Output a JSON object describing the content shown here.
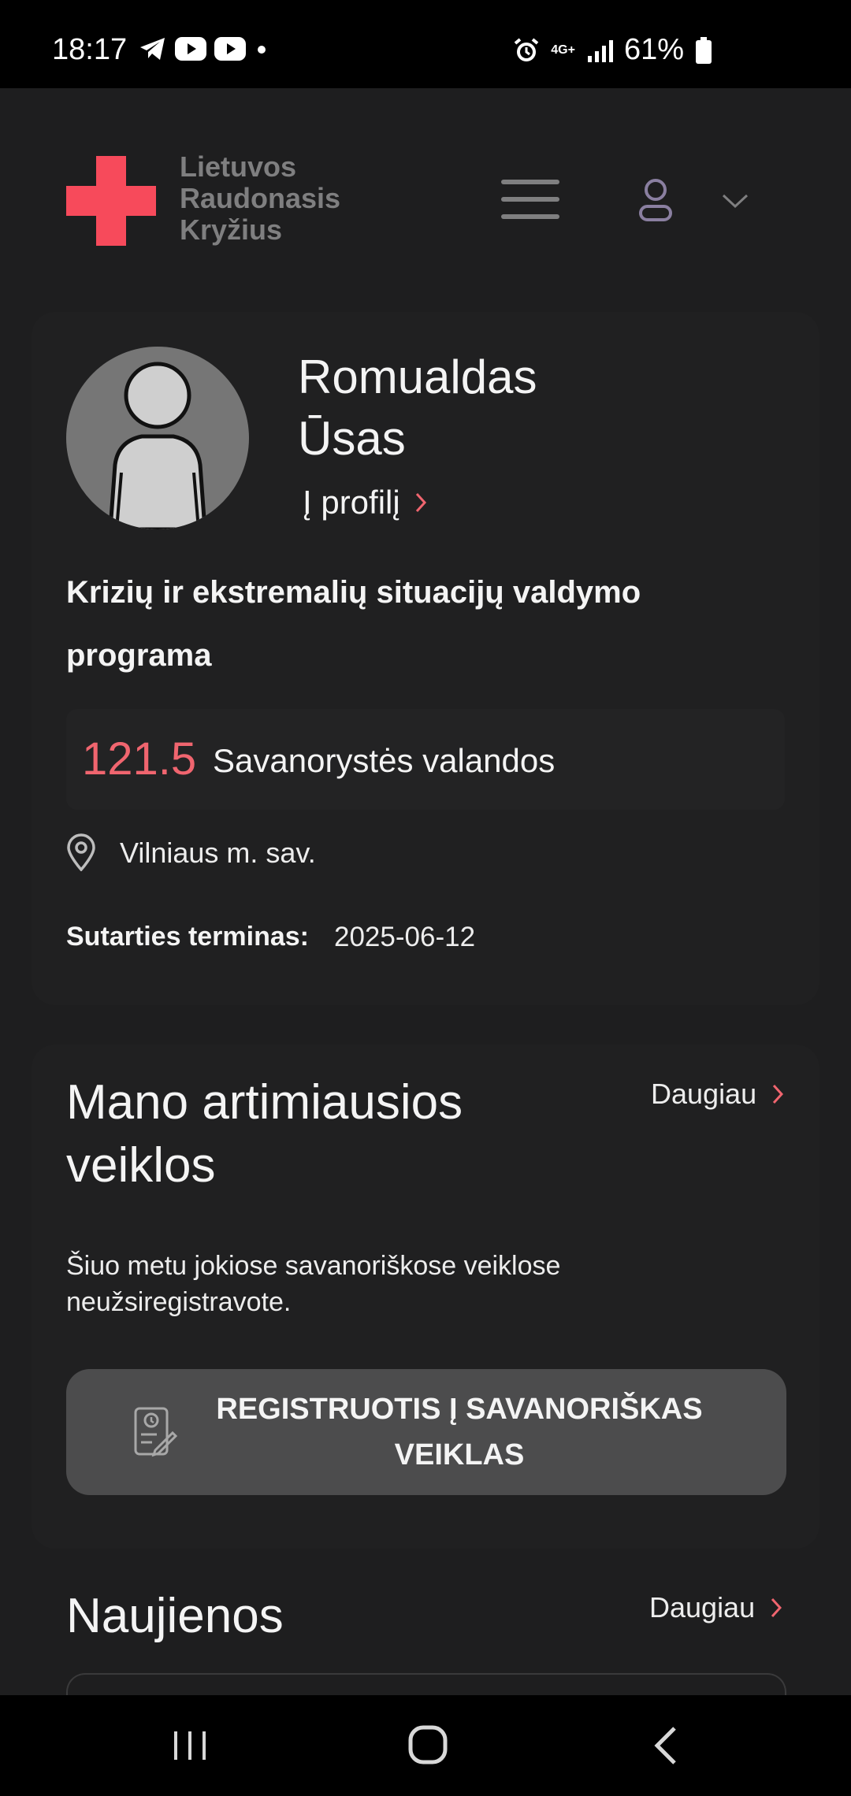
{
  "status_bar": {
    "time": "18:17",
    "battery": "61%",
    "network": "4G+"
  },
  "header": {
    "logo_lines": [
      "Lietuvos",
      "Raudonasis",
      "Kryžius"
    ],
    "menu_icon": "hamburger-icon",
    "user_icon": "user-icon",
    "dropdown_icon": "chevron-down-icon"
  },
  "profile": {
    "first_name": "Romualdas",
    "last_name": "Ūsas",
    "profile_link": "Į profilį",
    "program": "Krizių ir ekstremalių situacijų valdymo programa",
    "hours_value": "121.5",
    "hours_label": "Savanorystės valandos",
    "location": "Vilniaus m. sav.",
    "term_label": "Sutarties terminas:",
    "term_value": "2025-06-12"
  },
  "activities": {
    "title": "Mano artimiausios veiklos",
    "more_label": "Daugiau",
    "empty_text": "Šiuo metu jokiose savanoriškose veiklose neužsiregistravote.",
    "register_button": "REGISTRUOTIS Į SAVANORIŠKAS VEIKLAS"
  },
  "news": {
    "title": "Naujienos",
    "more_label": "Daugiau"
  },
  "colors": {
    "brand_red": "#f74a5b",
    "accent_number": "#f0656f",
    "background": "#1e1e1f",
    "button_bg": "#4c4c4d"
  }
}
